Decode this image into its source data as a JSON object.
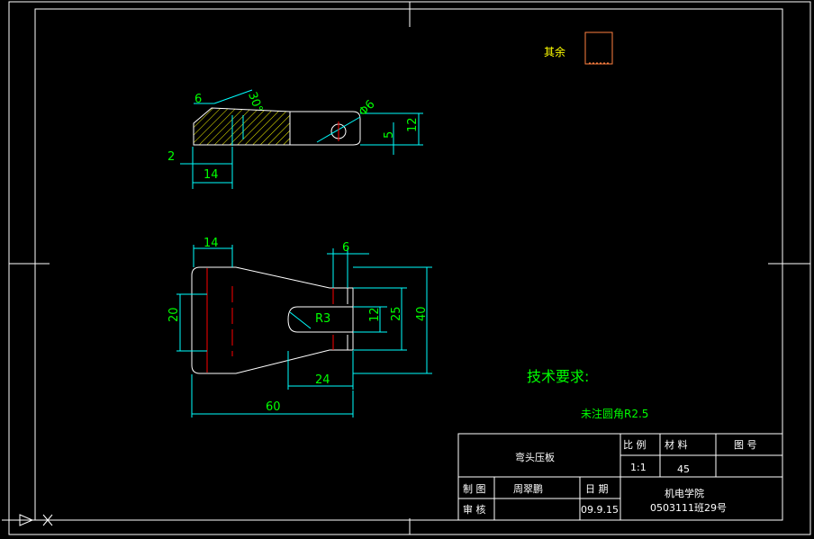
{
  "colors": {
    "background": "#000000",
    "border": "#ffffff",
    "geometry": "#ffffff",
    "dimension": "#00ffff",
    "dimension_text": "#00ff00",
    "hatch": "#ffff00",
    "center_line": "#ff0000",
    "roughness_box": "#ff8040"
  },
  "drawing": {
    "roughness_label": "其余",
    "front_view": {
      "dim_6": "6",
      "dim_30deg": "30°",
      "dim_phi6": "Φ6",
      "dim_2": "2",
      "dim_14": "14",
      "dim_5": "5",
      "dim_12": "12"
    },
    "top_view": {
      "dim_14": "14",
      "dim_6": "6",
      "dim_20": "20",
      "dim_r3": "R3",
      "dim_12": "12",
      "dim_25": "25",
      "dim_40": "40",
      "dim_24": "24",
      "dim_60": "60"
    },
    "tech_requirements": {
      "title": "技术要求:",
      "note": "未注圆角R2.5"
    }
  },
  "title_block": {
    "part_name": "弯头压板",
    "scale_header": "比 例",
    "material_header": "材 料",
    "drawing_no_header": "图 号",
    "scale_value": "1:1",
    "material_value": "45",
    "drawn_by_label": "制 图",
    "drawn_by_name": "周翠鹏",
    "date_label": "日 期",
    "checked_by_label": "审 核",
    "date_value": "09.9.15",
    "school": "机电学院",
    "class_id": "0503111班29号"
  }
}
